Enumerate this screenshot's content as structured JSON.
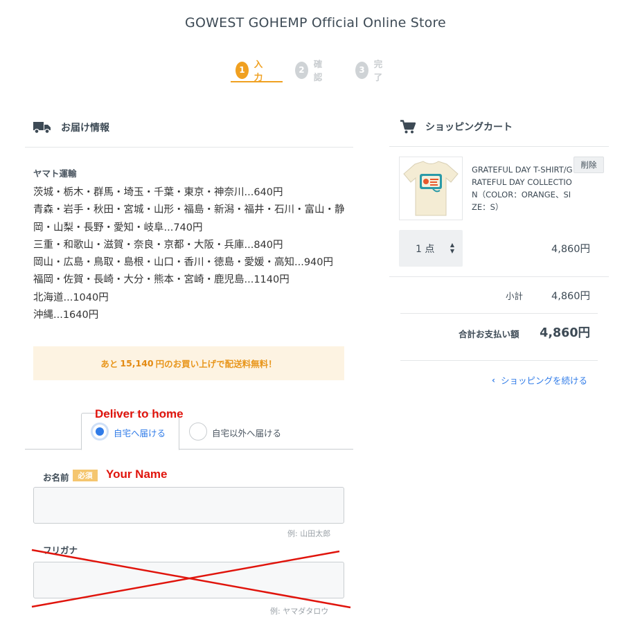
{
  "header": {
    "store_title": "GOWEST GOHEMP Official Online Store"
  },
  "steps": [
    {
      "num": "1",
      "label": "入力",
      "state": "active"
    },
    {
      "num": "2",
      "label": "確認",
      "state": "inactive"
    },
    {
      "num": "3",
      "label": "完了",
      "state": "inactive"
    }
  ],
  "delivery": {
    "title": "お届け情報",
    "icon": "truck-icon",
    "carrier": "ヤマト運輸",
    "rates": [
      "茨城・栃木・群馬・埼玉・千葉・東京・神奈川...640円",
      "青森・岩手・秋田・宮城・山形・福島・新潟・福井・石川・富山・静岡・山梨・長野・愛知・岐阜...740円",
      "三重・和歌山・滋賀・奈良・京都・大阪・兵庫...840円",
      "岡山・広島・鳥取・島根・山口・香川・徳島・愛媛・高知...940円",
      "福岡・佐賀・長崎・大分・熊本・宮崎・鹿児島...1140円",
      "北海道...1040円",
      "沖縄...1640円"
    ],
    "free_shipping": {
      "prefix": "あと",
      "amount": "15,140",
      "suffix": "円のお買い上げで配送料無料！"
    }
  },
  "delivery_tabs": [
    {
      "label": "自宅へ届ける",
      "selected": true
    },
    {
      "label": "自宅以外へ届ける",
      "selected": false
    }
  ],
  "annotations": {
    "deliver_to_home": "Deliver to home",
    "your_name": "Your Name",
    "color": "#e0140c"
  },
  "form": {
    "name": {
      "label": "お名前",
      "required_badge": "必須",
      "value": "",
      "hint": "例: 山田太郎"
    },
    "furigana": {
      "label": "フリガナ",
      "value": "",
      "hint": "例: ヤマダタロウ"
    }
  },
  "cart": {
    "title": "ショッピングカート",
    "icon": "cart-icon",
    "item": {
      "name": "GRATEFUL DAY T-SHIRT/GRATEFUL DAY COLLECTION（COLOR：ORANGE、SIZE：S）",
      "delete_label": "削除",
      "quantity": "1 点",
      "price": "4,860円"
    },
    "subtotal_label": "小計",
    "subtotal": "4,860円",
    "total_label": "合計お支払い額",
    "total": "4,860円",
    "continue_label": "ショッピングを続ける"
  },
  "colors": {
    "accent": "#f0a020",
    "link": "#2f7be8",
    "text": "#3d4a55",
    "notice_bg": "#fdf3e2"
  }
}
